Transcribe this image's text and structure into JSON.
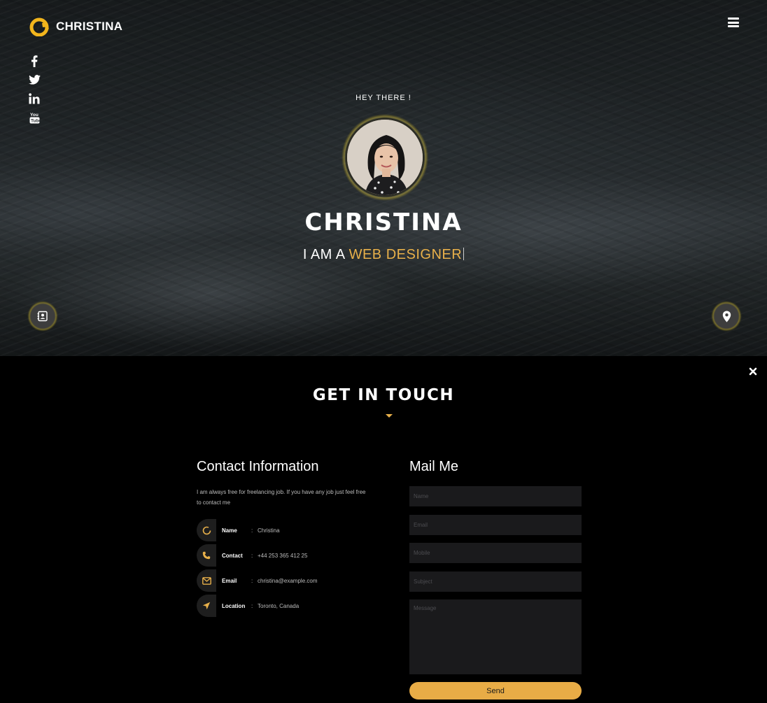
{
  "header": {
    "brand": "CHRISTINA",
    "menu_icon": "hamburger-icon",
    "social": [
      "facebook-icon",
      "twitter-icon",
      "linkedin-icon",
      "youtube-icon"
    ]
  },
  "hero": {
    "greeting": "HEY THERE !",
    "name": "CHRISTINA",
    "tagline_prefix": "I AM A",
    "tagline_role": "WEB DESIGNER",
    "left_button_icon": "contact-card-icon",
    "right_button_icon": "map-pin-icon"
  },
  "contact": {
    "title": "GET IN TOUCH",
    "close_icon": "close-icon",
    "info": {
      "heading": "Contact Information",
      "text": "I am always free for freelancing job. If you have any job just feel free to contact me",
      "rows": [
        {
          "icon": "loading-ring-icon",
          "label": "Name",
          "sep": ":",
          "value": "Christina"
        },
        {
          "icon": "phone-icon",
          "label": "Contact",
          "sep": ":",
          "value": "+44 253 365 412 25"
        },
        {
          "icon": "envelope-icon",
          "label": "Email",
          "sep": ":",
          "value": "christina@example.com"
        },
        {
          "icon": "location-arrow-icon",
          "label": "Location",
          "sep": ":",
          "value": "Toronto, Canada"
        }
      ]
    },
    "form": {
      "heading": "Mail Me",
      "name_placeholder": "Name",
      "email_placeholder": "Email",
      "mobile_placeholder": "Mobile",
      "subject_placeholder": "Subject",
      "message_placeholder": "Message",
      "send_label": "Send"
    }
  },
  "colors": {
    "accent": "#e8b04a",
    "button": "#e8ac46",
    "field_bg": "#1a1a1c"
  }
}
